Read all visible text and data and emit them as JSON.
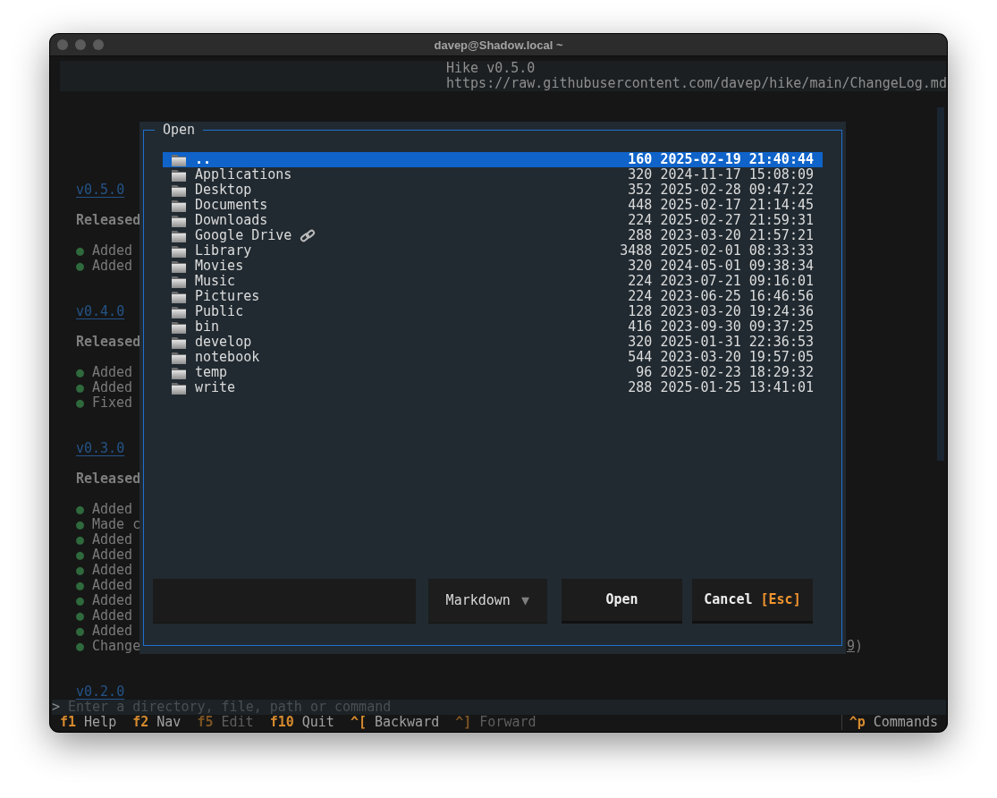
{
  "window": {
    "title": "davep@Shadow.local ~"
  },
  "header": {
    "title": "Hike v0.5.0",
    "location": "https://raw.githubusercontent.com/davep/hike/main/ChangeLog.md"
  },
  "document": {
    "sections": [
      {
        "heading": "v0.5.0",
        "released": "Released",
        "items": [
          {
            "bullet": "●",
            "text": "Added"
          },
          {
            "bullet": "●",
            "text": "Added"
          }
        ]
      },
      {
        "heading": "v0.4.0",
        "released": "Released",
        "items": [
          {
            "bullet": "●",
            "text": "Added"
          },
          {
            "bullet": "●",
            "text": "Added"
          },
          {
            "bullet": "●",
            "text": "Fixed"
          }
        ]
      },
      {
        "heading": "v0.3.0",
        "released": "Released",
        "items": [
          {
            "bullet": "●",
            "text": "Added"
          },
          {
            "bullet": "●",
            "text": "Made c"
          },
          {
            "bullet": "●",
            "text": "Added"
          },
          {
            "bullet": "●",
            "text": "Added"
          },
          {
            "bullet": "●",
            "text": "Added"
          },
          {
            "bullet": "●",
            "text": "Added"
          },
          {
            "bullet": "●",
            "text": "Added"
          },
          {
            "bullet": "●",
            "text": "Added"
          },
          {
            "bullet": "●",
            "text": "Added"
          },
          {
            "bullet": "●",
            "text": "Change",
            "tail_link": "9",
            "tail": ")"
          }
        ]
      },
      {
        "heading": "v0.2.0"
      }
    ]
  },
  "dialog": {
    "title": "Open",
    "entries": [
      {
        "name": "..",
        "size": "160",
        "modified": "2025-02-19 21:40:44",
        "selected": true,
        "symlink": false
      },
      {
        "name": "Applications",
        "size": "320",
        "modified": "2024-11-17 15:08:09",
        "selected": false,
        "symlink": false
      },
      {
        "name": "Desktop",
        "size": "352",
        "modified": "2025-02-28 09:47:22",
        "selected": false,
        "symlink": false
      },
      {
        "name": "Documents",
        "size": "448",
        "modified": "2025-02-17 21:14:45",
        "selected": false,
        "symlink": false
      },
      {
        "name": "Downloads",
        "size": "224",
        "modified": "2025-02-27 21:59:31",
        "selected": false,
        "symlink": false
      },
      {
        "name": "Google Drive",
        "size": "288",
        "modified": "2023-03-20 21:57:21",
        "selected": false,
        "symlink": true
      },
      {
        "name": "Library",
        "size": "3488",
        "modified": "2025-02-01 08:33:33",
        "selected": false,
        "symlink": false
      },
      {
        "name": "Movies",
        "size": "320",
        "modified": "2024-05-01 09:38:34",
        "selected": false,
        "symlink": false
      },
      {
        "name": "Music",
        "size": "224",
        "modified": "2023-07-21 09:16:01",
        "selected": false,
        "symlink": false
      },
      {
        "name": "Pictures",
        "size": "224",
        "modified": "2023-06-25 16:46:56",
        "selected": false,
        "symlink": false
      },
      {
        "name": "Public",
        "size": "128",
        "modified": "2023-03-20 19:24:36",
        "selected": false,
        "symlink": false
      },
      {
        "name": "bin",
        "size": "416",
        "modified": "2023-09-30 09:37:25",
        "selected": false,
        "symlink": false
      },
      {
        "name": "develop",
        "size": "320",
        "modified": "2025-01-31 22:36:53",
        "selected": false,
        "symlink": false
      },
      {
        "name": "notebook",
        "size": "544",
        "modified": "2023-03-20 19:57:05",
        "selected": false,
        "symlink": false
      },
      {
        "name": "temp",
        "size": "96",
        "modified": "2025-02-23 18:29:32",
        "selected": false,
        "symlink": false
      },
      {
        "name": "write",
        "size": "288",
        "modified": "2025-01-25 13:41:01",
        "selected": false,
        "symlink": false
      }
    ],
    "filter": {
      "value": "Markdown",
      "caret": "▼"
    },
    "buttons": [
      {
        "label": "Open"
      },
      {
        "label": "Cancel",
        "key": "[Esc]"
      }
    ]
  },
  "prompt": {
    "symbol": ">",
    "placeholder": "Enter a directory, file, path or command"
  },
  "footer": {
    "bindings": [
      {
        "key": "f1",
        "label": "Help",
        "disabled": false
      },
      {
        "key": "f2",
        "label": "Nav",
        "disabled": false
      },
      {
        "key": "f5",
        "label": "Edit",
        "disabled": true
      },
      {
        "key": "f10",
        "label": "Quit",
        "disabled": false
      },
      {
        "key": "^[",
        "label": "Backward",
        "disabled": false
      },
      {
        "key": "^]",
        "label": "Forward",
        "disabled": true
      }
    ],
    "commands": {
      "key": "^p",
      "label": "Commands"
    }
  }
}
